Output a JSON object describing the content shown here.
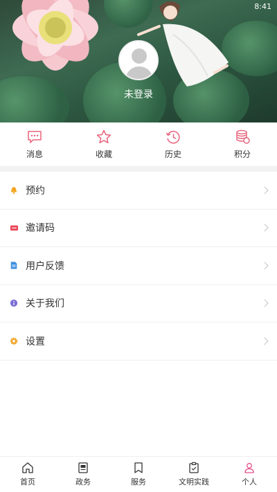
{
  "status_bar": {
    "time": "8:41"
  },
  "profile": {
    "login_text": "未登录",
    "avatar": "user-placeholder-icon"
  },
  "quick_actions": [
    {
      "label": "消息",
      "icon": "message-icon"
    },
    {
      "label": "收藏",
      "icon": "star-icon"
    },
    {
      "label": "历史",
      "icon": "history-icon"
    },
    {
      "label": "积分",
      "icon": "coins-icon"
    }
  ],
  "menu": [
    {
      "label": "预约",
      "icon": "bell-icon"
    },
    {
      "label": "邀请码",
      "icon": "ticket-icon"
    },
    {
      "label": "用户反馈",
      "icon": "feedback-icon"
    },
    {
      "label": "关于我们",
      "icon": "info-icon"
    },
    {
      "label": "设置",
      "icon": "gear-icon"
    }
  ],
  "tabbar": [
    {
      "label": "首页",
      "icon": "home-icon"
    },
    {
      "label": "政务",
      "icon": "document-icon"
    },
    {
      "label": "服务",
      "icon": "bookmark-icon"
    },
    {
      "label": "文明实践",
      "icon": "clipboard-icon"
    },
    {
      "label": "个人",
      "icon": "person-icon",
      "active": true
    }
  ],
  "colors": {
    "accent": "#e8627a",
    "active_tab": "#e64d8a",
    "chevron": "#c4c4c4"
  }
}
